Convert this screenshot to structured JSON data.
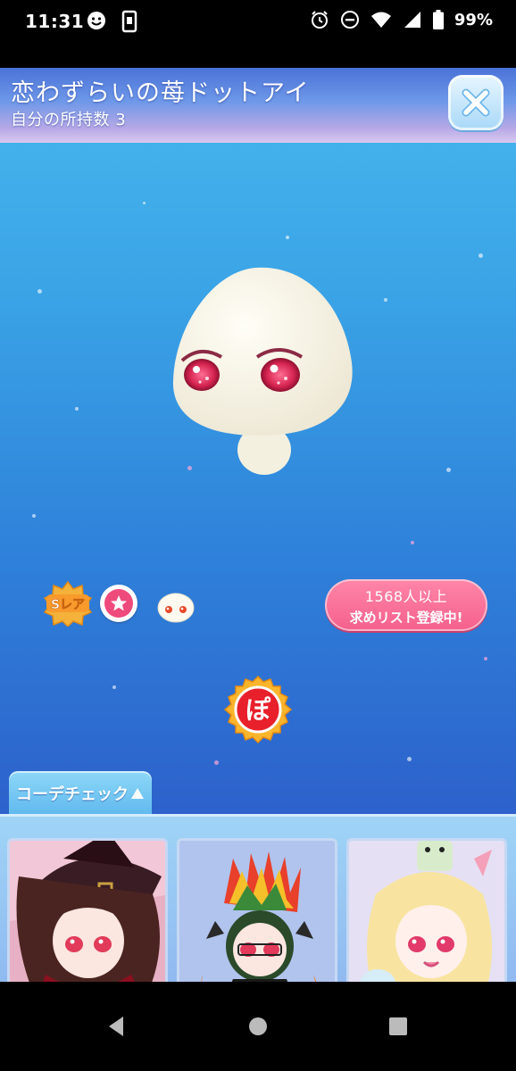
{
  "status_bar": {
    "time": "11:31",
    "battery": "99%",
    "icons_left": [
      "smiley-icon",
      "screenshot-icon"
    ],
    "icons_right": [
      "alarm-icon",
      "dnd-icon",
      "wifi-icon",
      "signal-icon",
      "battery-icon"
    ]
  },
  "header": {
    "item_name": "恋わずらいの苺ドットアイ",
    "owned_count": "自分の所持数 3",
    "close_icon": "close-icon"
  },
  "badges": {
    "rarity": "Sレア",
    "wishlist_count": "1568人以上",
    "wishlist_text": "求めリスト登録中!"
  },
  "po_button": {
    "label": "ぽ"
  },
  "coordinate_check": {
    "tab_label": "コーデチェック",
    "cards": [
      {
        "name": "coord-card-witch"
      },
      {
        "name": "coord-card-rainbow"
      },
      {
        "name": "coord-card-blonde"
      }
    ]
  },
  "nav": {
    "back_icon": "back-icon",
    "home_icon": "home-icon",
    "recents_icon": "recents-icon"
  },
  "colors": {
    "background_top": "#47b8ee",
    "background_bottom": "#3453c6",
    "wishlist_pink": "#f4608c",
    "eye_red": "#d4234f"
  }
}
